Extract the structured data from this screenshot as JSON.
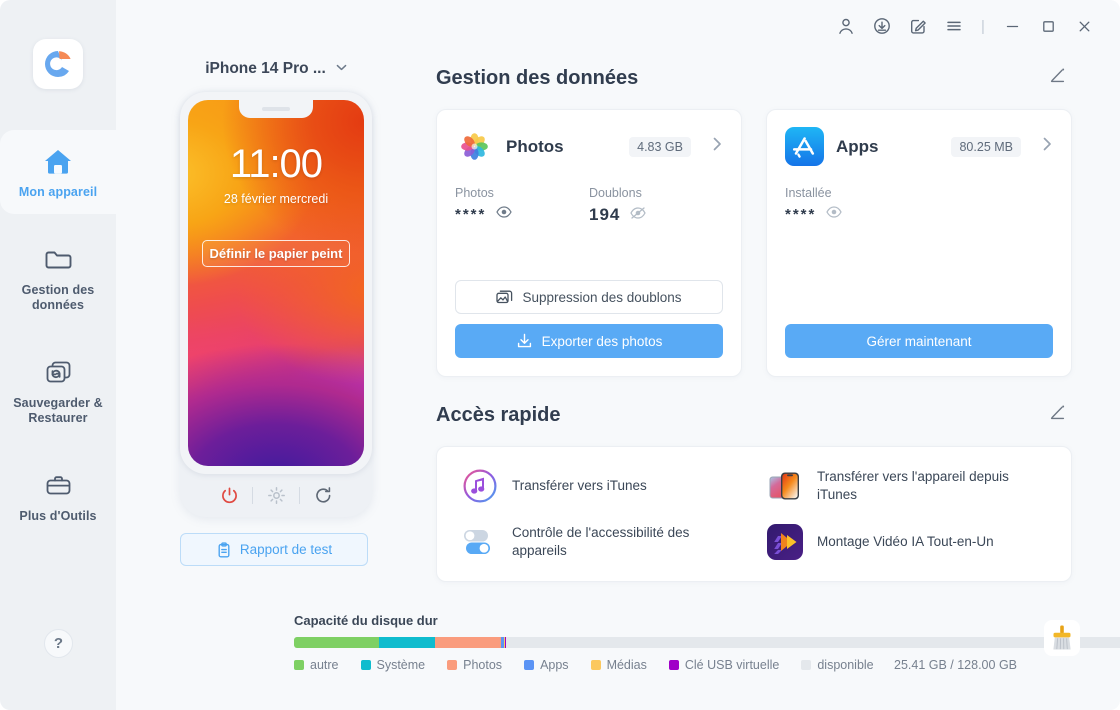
{
  "titlebar": {
    "buttons": [
      {
        "name": "account-icon",
        "label": "Compte"
      },
      {
        "name": "download-icon",
        "label": "Téléchargements"
      },
      {
        "name": "feedback-icon",
        "label": "Commentaires"
      },
      {
        "name": "menu-icon",
        "label": "Menu"
      }
    ],
    "separator": "|",
    "minimize": "—",
    "maximize": "□",
    "close": "✕"
  },
  "sidebar": {
    "logo_alt": "app-logo",
    "items": [
      {
        "label": "Mon appareil",
        "icon": "home-icon",
        "active": true
      },
      {
        "label": "Gestion des données",
        "icon": "folder-icon",
        "active": false
      },
      {
        "label": "Sauvegarder & Restaurer",
        "icon": "backup-restore-icon",
        "active": false
      },
      {
        "label": "Plus d'Outils",
        "icon": "toolbox-icon",
        "active": false
      }
    ],
    "help_label": "?"
  },
  "device": {
    "name": "iPhone 14 Pro ...",
    "chevron": "⌄",
    "lock_time": "11:00",
    "lock_date": "28 février mercredi",
    "wallpaper_button": "Définir le papier peint",
    "controls": [
      {
        "name": "power-icon",
        "label": "Éteindre"
      },
      {
        "name": "brightness-icon",
        "label": "Luminosité"
      },
      {
        "name": "refresh-icon",
        "label": "Actualiser"
      }
    ],
    "report_button": "Rapport de test"
  },
  "data_management": {
    "title": "Gestion des données",
    "edit_icon": "pencil-icon",
    "cards": [
      {
        "name": "Photos",
        "icon": "photos-app-icon",
        "size": "4.83 GB",
        "chevron": "›",
        "stats": [
          {
            "label": "Photos",
            "value": "****",
            "eye": "eye-open-icon"
          },
          {
            "label": "Doublons",
            "value": "194",
            "eye": "eye-off-icon"
          }
        ],
        "secondary_button": "Suppression des doublons",
        "secondary_icon": "photo-stack-icon",
        "primary_button": "Exporter des photos",
        "primary_icon": "download-icon"
      },
      {
        "name": "Apps",
        "icon": "appstore-app-icon",
        "size": "80.25 MB",
        "chevron": "›",
        "stats": [
          {
            "label": "Installée",
            "value": "****",
            "eye": "eye-open-icon"
          }
        ],
        "primary_button": "Gérer maintenant"
      }
    ]
  },
  "quick_access": {
    "title": "Accès rapide",
    "edit_icon": "pencil-icon",
    "items": [
      {
        "label": "Transférer vers iTunes",
        "icon": "itunes-icon"
      },
      {
        "label": "Transférer vers l'appareil depuis iTunes",
        "icon": "phone-transfer-icon"
      },
      {
        "label": "Contrôle de l'accessibilité des appareils",
        "icon": "toggles-icon"
      },
      {
        "label": "Montage Vidéo IA Tout-en-Un",
        "icon": "video-editor-icon"
      }
    ]
  },
  "disk": {
    "title": "Capacité du disque dur",
    "total_text": "25.41 GB / 128.00 GB",
    "cleaner_icon": "broom-icon",
    "segments": [
      {
        "label": "autre",
        "color": "#7ed063",
        "percent": 10.2
      },
      {
        "label": "Système",
        "color": "#0fbcce",
        "percent": 6.7
      },
      {
        "label": "Photos",
        "color": "#fa9c7d",
        "percent": 7.9
      },
      {
        "label": "Apps",
        "color": "#5b94f5",
        "percent": 0.35
      },
      {
        "label": "Médias",
        "color": "#fbc85f",
        "percent": 0.18
      },
      {
        "label": "Clé USB virtuelle",
        "color": "#a000c8",
        "percent": 0.12
      },
      {
        "label": "disponible",
        "color": "#e4e8ec",
        "percent": 74.55
      }
    ]
  },
  "colors": {
    "accent": "#59aaf5",
    "sidebar_bg": "#eef1f4",
    "main_bg": "#f7f9fb"
  }
}
